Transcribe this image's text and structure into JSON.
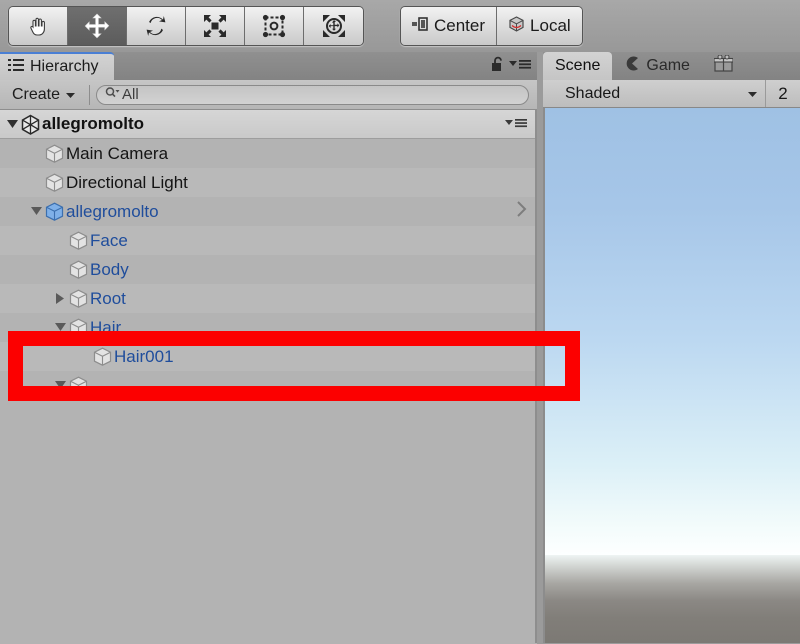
{
  "toolbar": {
    "transform_tools": [
      {
        "name": "hand-tool",
        "icon": "hand-icon",
        "active": false
      },
      {
        "name": "move-tool",
        "icon": "move-arrows-icon",
        "active": true
      },
      {
        "name": "rotate-tool",
        "icon": "rotate-icon",
        "active": false
      },
      {
        "name": "scale-tool",
        "icon": "scale-icon",
        "active": false
      },
      {
        "name": "rect-tool",
        "icon": "rect-transform-icon",
        "active": false
      },
      {
        "name": "transform-tool",
        "icon": "transform-icon",
        "active": false
      }
    ],
    "pivot_mode": {
      "label": "Center",
      "icon": "pivot-center-icon"
    },
    "pivot_rotation": {
      "label": "Local",
      "icon": "local-cube-icon"
    }
  },
  "hierarchy": {
    "tab_label": "Hierarchy",
    "tab_icon": "hierarchy-list-icon",
    "lock_icon": "unlocked-padlock-icon",
    "menu_icon": "panel-menu-icon",
    "create_label": "Create",
    "create_dropdown_icon": "chevron-down-icon",
    "search_icon": "search-magnifier-icon",
    "search_value": "All",
    "search_placeholder": "All",
    "scene_name": "allegromolto",
    "scene_icon": "unity-logo-icon",
    "scene_menu_icon": "panel-menu-icon",
    "items": [
      {
        "label": "Main Camera",
        "indent": 1,
        "foldout": "none",
        "style": "plain",
        "icon": "gameobject-cube-icon",
        "chevron": false
      },
      {
        "label": "Directional Light",
        "indent": 1,
        "foldout": "none",
        "style": "plain",
        "icon": "gameobject-cube-icon",
        "chevron": false
      },
      {
        "label": "allegromolto",
        "indent": 1,
        "foldout": "expanded",
        "style": "prefab",
        "icon": "prefab-blue-cube-icon",
        "chevron": true
      },
      {
        "label": "Face",
        "indent": 2,
        "foldout": "none",
        "style": "prefab",
        "icon": "gameobject-cube-icon",
        "chevron": false
      },
      {
        "label": "Body",
        "indent": 2,
        "foldout": "none",
        "style": "prefab",
        "icon": "gameobject-cube-icon",
        "chevron": false
      },
      {
        "label": "Root",
        "indent": 2,
        "foldout": "collapsed",
        "style": "prefab",
        "icon": "gameobject-cube-icon",
        "chevron": false
      },
      {
        "label": "Hair",
        "indent": 2,
        "foldout": "expanded",
        "style": "prefab",
        "icon": "gameobject-cube-icon",
        "chevron": false
      },
      {
        "label": "Hair001",
        "indent": 3,
        "foldout": "none",
        "style": "prefab",
        "icon": "gameobject-cube-icon",
        "chevron": false
      },
      {
        "label": "",
        "indent": 2,
        "foldout": "expanded",
        "style": "prefab",
        "icon": "gameobject-cube-icon",
        "chevron": false
      }
    ]
  },
  "scene": {
    "tabs": [
      {
        "label": "Scene",
        "icon": "scene-icon",
        "active": true
      },
      {
        "label": "Game",
        "icon": "game-pacman-icon",
        "active": false
      },
      {
        "label": "",
        "icon": "asset-store-gift-icon",
        "active": false
      }
    ],
    "draw_mode": "Shaded",
    "draw_mode_icon": "chevron-down-icon",
    "two_d_label": "2"
  },
  "annotation": {
    "shape": "rectangle-outline",
    "color": "#fc0000",
    "targets": "Hair001"
  }
}
